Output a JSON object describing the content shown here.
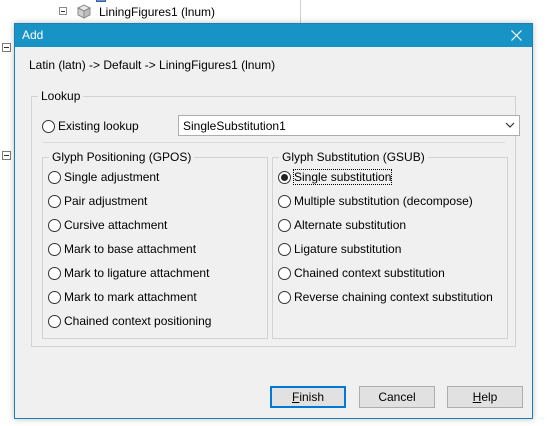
{
  "background": {
    "tree_node_label": "LiningFigures1 (lnum)"
  },
  "dialog": {
    "title": "Add",
    "breadcrumb": "Latin (latn) -> Default -> LiningFigures1 (lnum)",
    "lookup_group": {
      "title": "Lookup",
      "existing_lookup_label": "Existing lookup",
      "combo_value": "SingleSubstitution1"
    },
    "gpos": {
      "title": "Glyph Positioning (GPOS)",
      "options": [
        "Single adjustment",
        "Pair adjustment",
        "Cursive attachment",
        "Mark to base attachment",
        "Mark to ligature attachment",
        "Mark to mark attachment",
        "Chained context positioning"
      ]
    },
    "gsub": {
      "title": "Glyph Substitution (GSUB)",
      "selected": "Single substitution",
      "options": [
        "Single substitution",
        "Multiple substitution (decompose)",
        "Alternate substitution",
        "Ligature substitution",
        "Chained context substitution",
        "Reverse chaining context substitution"
      ]
    },
    "buttons": {
      "finish": {
        "first": "F",
        "rest": "inish"
      },
      "cancel": "Cancel",
      "help": {
        "first": "H",
        "rest": "elp"
      }
    }
  },
  "colors": {
    "titlebar": "#1793c5",
    "dialog_bg": "#f0f0f0",
    "default_button_border": "#0078d7"
  }
}
